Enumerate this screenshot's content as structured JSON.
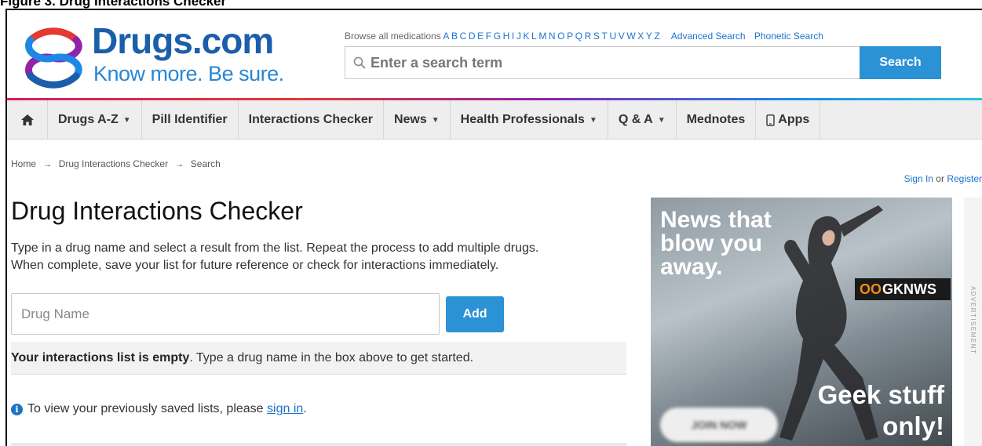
{
  "caption": "Figure 3. Drug Interactions Checker",
  "header": {
    "logo_name": "Drugs.com",
    "logo_tagline": "Know more. Be sure.",
    "browse_label": "Browse all medications",
    "letters": [
      "A",
      "B",
      "C",
      "D",
      "E",
      "F",
      "G",
      "H",
      "I",
      "J",
      "K",
      "L",
      "M",
      "N",
      "O",
      "P",
      "Q",
      "R",
      "S",
      "T",
      "U",
      "V",
      "W",
      "X",
      "Y",
      "Z"
    ],
    "advanced_search": "Advanced Search",
    "phonetic_search": "Phonetic Search",
    "search_placeholder": "Enter a search term",
    "search_button": "Search"
  },
  "nav": {
    "items": [
      {
        "label": "Drugs A-Z",
        "dropdown": true
      },
      {
        "label": "Pill Identifier",
        "dropdown": false
      },
      {
        "label": "Interactions Checker",
        "dropdown": false
      },
      {
        "label": "News",
        "dropdown": true
      },
      {
        "label": "Health Professionals",
        "dropdown": true
      },
      {
        "label": "Q & A",
        "dropdown": true
      },
      {
        "label": "Mednotes",
        "dropdown": false
      },
      {
        "label": "Apps",
        "dropdown": false
      }
    ],
    "chevron": "⌄"
  },
  "breadcrumb": {
    "items": [
      "Home",
      "Drug Interactions Checker",
      "Search"
    ],
    "arrow": "→"
  },
  "auth": {
    "sign_in": "Sign In",
    "or": "or",
    "register": "Register"
  },
  "main": {
    "title": "Drug Interactions Checker",
    "intro_line1": "Type in a drug name and select a result from the list. Repeat the process to add multiple drugs.",
    "intro_line2": "When complete, save your list for future reference or check for interactions immediately.",
    "drug_input_placeholder": "Drug Name",
    "add_button": "Add",
    "empty_bold": "Your interactions list is empty",
    "empty_rest": ". Type a drug name in the box above to get started.",
    "saved_prefix": "To view your previously saved lists, please",
    "saved_link": "sign in",
    "saved_suffix": "."
  },
  "ad": {
    "headline_line1": "News that",
    "headline_line2": "blow you",
    "headline_line3": "away.",
    "brand_oo": "OO",
    "brand_text": "GKNWS",
    "geek_line1": "Geek stuff",
    "geek_line2": "only!",
    "join_label": "JOIN NOW",
    "side_label": "ADVERTISEMENT"
  },
  "colors": {
    "brand_blue": "#1b5eab",
    "button_blue": "#2a92d5",
    "link_blue": "#1a73d1"
  }
}
